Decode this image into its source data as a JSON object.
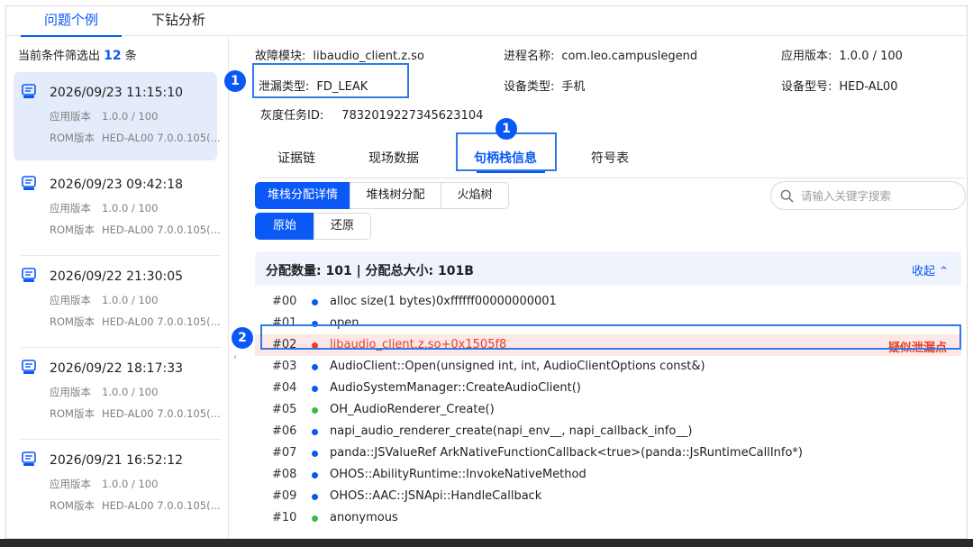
{
  "tabs": {
    "issue": "问题个例",
    "drill": "下钻分析"
  },
  "filter": {
    "prefix": "当前条件筛选出",
    "count": "12",
    "suffix": "条"
  },
  "items": [
    {
      "date": "2026/09/23 11:15:10",
      "app_version_label": "应用版本",
      "app_version": "1.0.0 / 100",
      "rom_label": "ROM版本",
      "rom": "HED-AL00 7.0.0.105(..."
    },
    {
      "date": "2026/09/23 09:42:18",
      "app_version_label": "应用版本",
      "app_version": "1.0.0 / 100",
      "rom_label": "ROM版本",
      "rom": "HED-AL00 7.0.0.105(..."
    },
    {
      "date": "2026/09/22 21:30:05",
      "app_version_label": "应用版本",
      "app_version": "1.0.0 / 100",
      "rom_label": "ROM版本",
      "rom": "HED-AL00 7.0.0.105(..."
    },
    {
      "date": "2026/09/22 18:17:33",
      "app_version_label": "应用版本",
      "app_version": "1.0.0 / 100",
      "rom_label": "ROM版本",
      "rom": "HED-AL00 7.0.0.105(..."
    },
    {
      "date": "2026/09/21 16:52:12",
      "app_version_label": "应用版本",
      "app_version": "1.0.0 / 100",
      "rom_label": "ROM版本",
      "rom": "HED-AL00 7.0.0.105(..."
    }
  ],
  "info": {
    "module_label": "故障模块:",
    "module": "libaudio_client.z.so",
    "process_label": "进程名称:",
    "process": "com.leo.campuslegend",
    "appver_label": "应用版本:",
    "appver": "1.0.0 / 100",
    "leak_label": "泄漏类型:",
    "leak": "FD_LEAK",
    "device_type_label": "设备类型:",
    "device_type": "手机",
    "device_model_label": "设备型号:",
    "device_model": "HED-AL00",
    "task_label": "灰度任务ID:",
    "task": "7832019227345623104"
  },
  "badges": {
    "b1": "1",
    "b2": "1",
    "b3": "2"
  },
  "section_tabs": {
    "evidence": "证据链",
    "scene": "现场数据",
    "handle": "句柄栈信息",
    "symbols": "符号表"
  },
  "sub_tabs": {
    "detail": "堆栈分配详情",
    "tree": "堆栈树分配",
    "flame": "火焰树"
  },
  "mode": {
    "original": "原始",
    "restore": "还原"
  },
  "search": {
    "placeholder": "请输入关键字搜索"
  },
  "stack": {
    "summary": "分配数量: 101 | 分配总大小: 101B",
    "collapse": "收起",
    "suspect_tag": "疑似泄漏点",
    "frames": [
      {
        "idx": "#00",
        "fn": "alloc size(1 bytes)0xffffff00000000001",
        "color": "#0a59f7"
      },
      {
        "idx": "#01",
        "fn": "open",
        "color": "#0a59f7"
      },
      {
        "idx": "#02",
        "fn": "libaudio_client.z.so+0x1505f8",
        "color": "#e84026"
      },
      {
        "idx": "#03",
        "fn": "AudioClient::Open(unsigned int, int, AudioClientOptions const&)",
        "color": "#0a59f7"
      },
      {
        "idx": "#04",
        "fn": "AudioSystemManager::CreateAudioClient()",
        "color": "#0a59f7"
      },
      {
        "idx": "#05",
        "fn": "OH_AudioRenderer_Create()",
        "color": "#41ba41"
      },
      {
        "idx": "#06",
        "fn": "napi_audio_renderer_create(napi_env__, napi_callback_info__)",
        "color": "#0a59f7"
      },
      {
        "idx": "#07",
        "fn": "panda::JSValueRef ArkNativeFunctionCallback<true>(panda::JsRuntimeCallInfo*)",
        "color": "#0a59f7"
      },
      {
        "idx": "#08",
        "fn": "OHOS::AbilityRuntime::InvokeNativeMethod",
        "color": "#0a59f7"
      },
      {
        "idx": "#09",
        "fn": "OHOS::AAC::JSNApi::HandleCallback",
        "color": "#0a59f7"
      },
      {
        "idx": "#10",
        "fn": "anonymous",
        "color": "#41ba41"
      }
    ]
  }
}
